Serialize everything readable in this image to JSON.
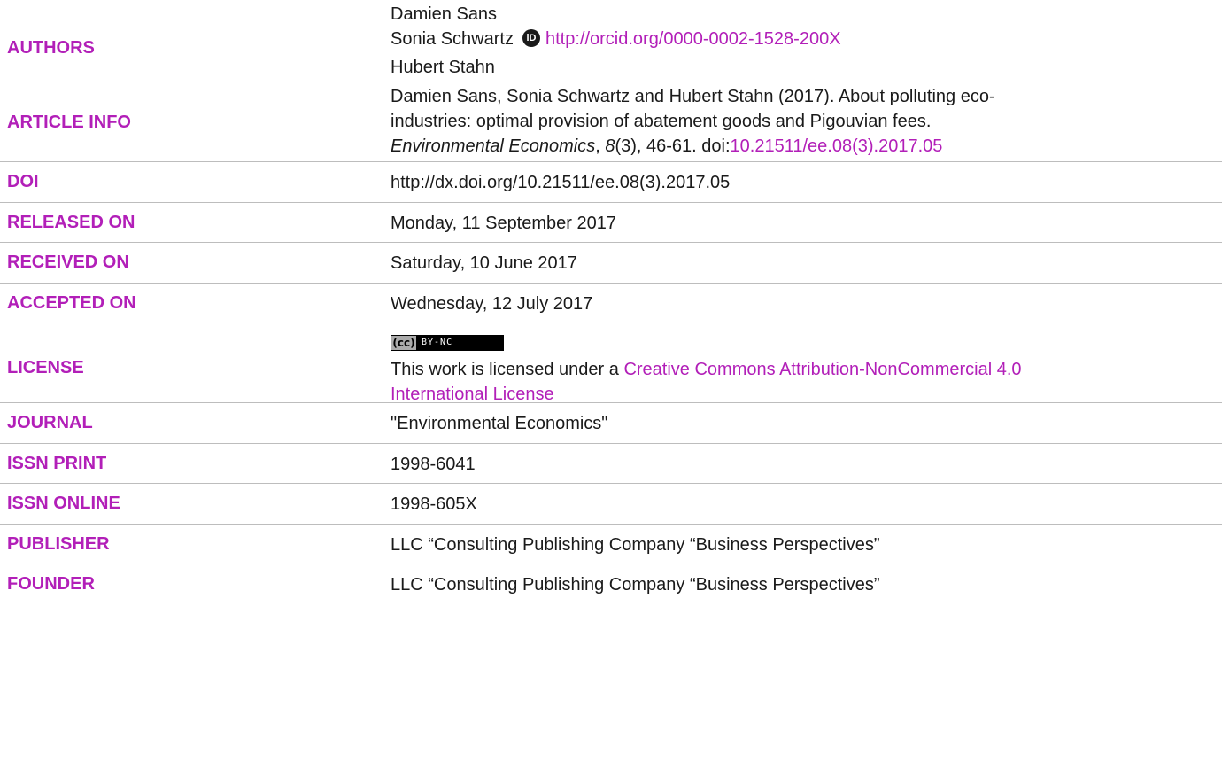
{
  "authors": {
    "label": "AUTHORS",
    "names": [
      "Damien Sans",
      "Sonia Schwartz",
      "Hubert Stahn"
    ],
    "orcid_icon": "orcid-icon",
    "orcid_link": "http://orcid.org/0000-0002-1528-200X"
  },
  "article_info": {
    "label": "ARTICLE INFO",
    "text_line1": "Damien Sans, Sonia Schwartz and Hubert Stahn (2017). About polluting eco-",
    "text_line2": "industries: optimal provision of abatement goods and Pigouvian fees.",
    "journal_italic": "Environmental Economics",
    "volume_italic": "8",
    "citation_rest": "(3), 46-61. doi:",
    "doi_link": "10.21511/ee.08(3).2017.05",
    "comma": ", "
  },
  "doi": {
    "label": "DOI",
    "value": "http://dx.doi.org/10.21511/ee.08(3).2017.05"
  },
  "released_on": {
    "label": "RELEASED ON",
    "value": "Monday, 11 September 2017"
  },
  "received_on": {
    "label": "RECEIVED ON",
    "value": "Saturday, 10 June 2017"
  },
  "accepted_on": {
    "label": "ACCEPTED ON",
    "value": "Wednesday, 12 July 2017"
  },
  "license": {
    "label": "LICENSE",
    "badge_icon": "cc-by-nc-icon",
    "badge_cc": "(cc)",
    "badge_text": "BY-NC",
    "text_prefix": "This work is licensed under a ",
    "link_line1": "Creative Commons Attribution-NonCommercial 4.0",
    "link_line2": "International License"
  },
  "journal": {
    "label": "JOURNAL",
    "value": "\"Environmental Economics\""
  },
  "issn_print": {
    "label": "ISSN PRINT",
    "value": "1998-6041"
  },
  "issn_online": {
    "label": "ISSN ONLINE",
    "value": "1998-605X"
  },
  "publisher": {
    "label": "PUBLISHER",
    "value": "LLC “Consulting Publishing Company “Business Perspectives”"
  },
  "founder": {
    "label": "FOUNDER",
    "value": "LLC “Consulting Publishing Company “Business Perspectives”"
  },
  "colors": {
    "accent": "#b21fb8",
    "text": "#1a1a1a",
    "rule": "#bdbdbd"
  }
}
